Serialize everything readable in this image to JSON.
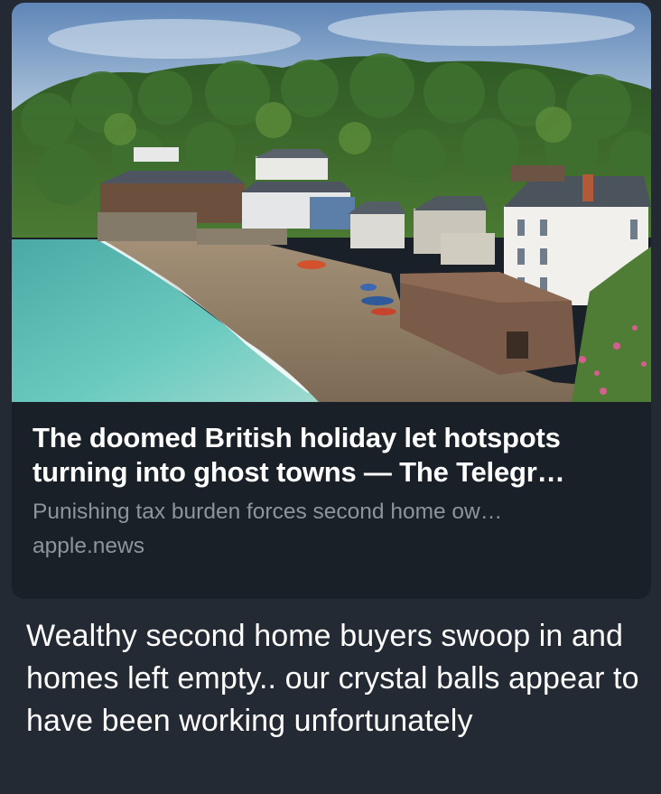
{
  "link_preview": {
    "title": "The doomed British holiday let hotspots turning into ghost towns — The Telegr…",
    "description": "Punishing tax burden forces second home ow…",
    "domain": "apple.news",
    "image": {
      "subject": "Coastal village with whitewashed cottages above a sandy cove, backed by a wooded hillside",
      "colors": {
        "sky": "#7a9fc6",
        "trees": "#3d6b2a",
        "sea": "#5bbfb5",
        "sand": "#9e8a70",
        "wall": "#7a5c4a"
      }
    }
  },
  "message": {
    "text": "Wealthy second home buyers swoop in and homes left empty.. our crystal balls appear to have been working unfortunately"
  },
  "theme": {
    "background": "#232a33",
    "card_background": "#1a2028",
    "title_color": "#ffffff",
    "muted_text_color": "#8d949c"
  }
}
